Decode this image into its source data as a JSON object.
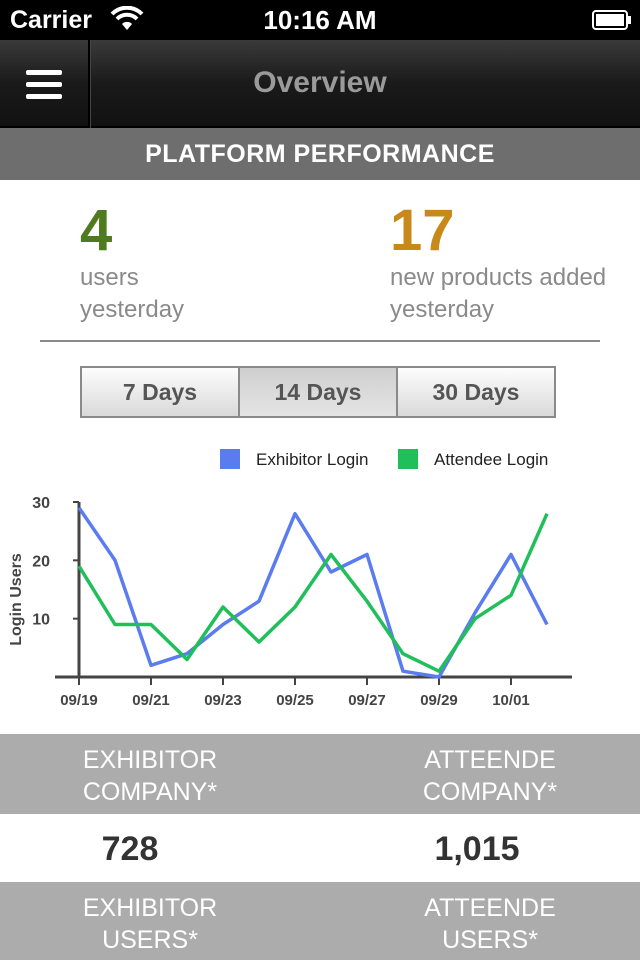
{
  "status_bar": {
    "carrier": "Carrier",
    "time": "10:16 AM"
  },
  "nav": {
    "title": "Overview"
  },
  "section": {
    "title": "PLATFORM PERFORMANCE"
  },
  "stats": {
    "users": {
      "value": "4",
      "label": "users\nyesterday"
    },
    "products": {
      "value": "17",
      "label": "new products added\nyesterday"
    }
  },
  "range_tabs": [
    {
      "label": "7 Days",
      "selected": false
    },
    {
      "label": "14 Days",
      "selected": true
    },
    {
      "label": "30 Days",
      "selected": false
    }
  ],
  "chart_data": {
    "type": "line",
    "ylabel": "Login Users",
    "xlabel": "",
    "ylim": [
      0,
      30
    ],
    "yticks": [
      10,
      20,
      30
    ],
    "x": [
      "09/19",
      "09/20",
      "09/21",
      "09/22",
      "09/23",
      "09/24",
      "09/25",
      "09/26",
      "09/27",
      "09/28",
      "09/29",
      "09/30",
      "10/01",
      "10/02"
    ],
    "xtick_labels": [
      "09/19",
      "09/21",
      "09/23",
      "09/25",
      "09/27",
      "09/29",
      "10/01"
    ],
    "legend": "top-right",
    "series": [
      {
        "name": "Exhibitor Login",
        "color": "#5b7cf0",
        "values": [
          29,
          20,
          2,
          4,
          9,
          13,
          28,
          18,
          21,
          1,
          0,
          11,
          21,
          9
        ]
      },
      {
        "name": "Attendee Login",
        "color": "#1fbf5a",
        "values": [
          19,
          9,
          9,
          3,
          12,
          6,
          12,
          21,
          13,
          4,
          1,
          10,
          14,
          28
        ]
      }
    ]
  },
  "metrics": {
    "exhibitor_company": {
      "label": "EXHIBITOR\nCOMPANY*",
      "value": "728"
    },
    "attendee_company": {
      "label": "ATTEENDE\nCOMPANY*",
      "value": "1,015"
    },
    "exhibitor_users": {
      "label": "EXHIBITOR\nUSERS*"
    },
    "attendee_users": {
      "label": "ATTEENDE\nUSERS*"
    }
  }
}
